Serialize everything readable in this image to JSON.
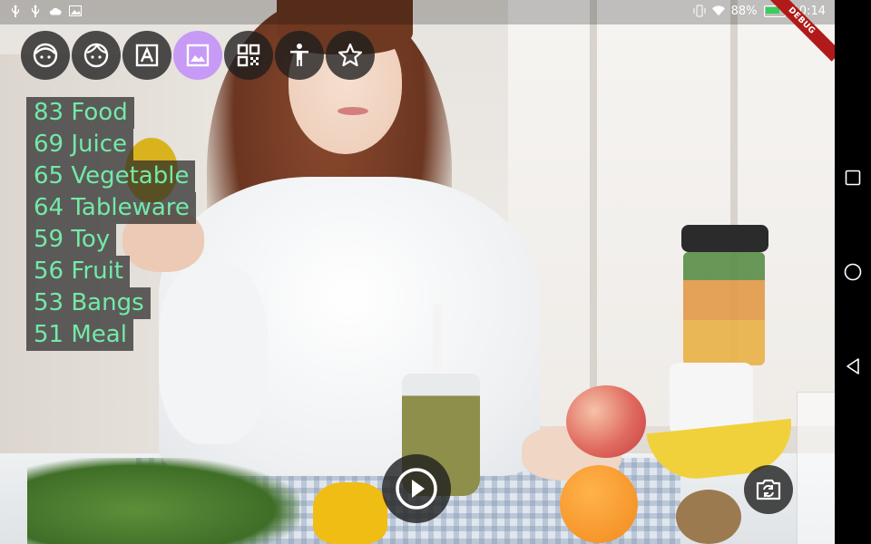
{
  "status_bar": {
    "battery_percent": "88%",
    "time": "10:14",
    "left_icons": [
      "usb-icon",
      "usb-icon",
      "cloud-icon",
      "image-icon"
    ],
    "right_icons": [
      "vibrate-icon",
      "wifi-icon",
      "battery-icon"
    ]
  },
  "debug_banner": "DEBUG",
  "mode_buttons": [
    {
      "name": "face-detection",
      "icon": "face-icon",
      "active": false
    },
    {
      "name": "face-contour",
      "icon": "face-outline-icon",
      "active": false
    },
    {
      "name": "text-recognition",
      "icon": "text-icon",
      "active": false
    },
    {
      "name": "image-labeling",
      "icon": "image-icon",
      "active": true
    },
    {
      "name": "barcode-scanning",
      "icon": "qr-code-icon",
      "active": false
    },
    {
      "name": "pose-detection",
      "icon": "person-icon",
      "active": false
    },
    {
      "name": "favorites",
      "icon": "star-icon",
      "active": false
    }
  ],
  "labels": [
    "83 Food",
    "69 Juice",
    "65 Vegetable",
    "64 Tableware",
    "59 Toy",
    "56 Fruit",
    "53 Bangs",
    "51 Meal"
  ],
  "controls": {
    "play_icon": "play-icon",
    "switch_camera_icon": "switch-camera-icon"
  },
  "colors": {
    "label_text": "#73eaa8",
    "active_mode": "#c69af5",
    "debug_ribbon": "#b01a1a"
  },
  "navigation": [
    "square-icon",
    "circle-icon",
    "triangle-back-icon"
  ]
}
